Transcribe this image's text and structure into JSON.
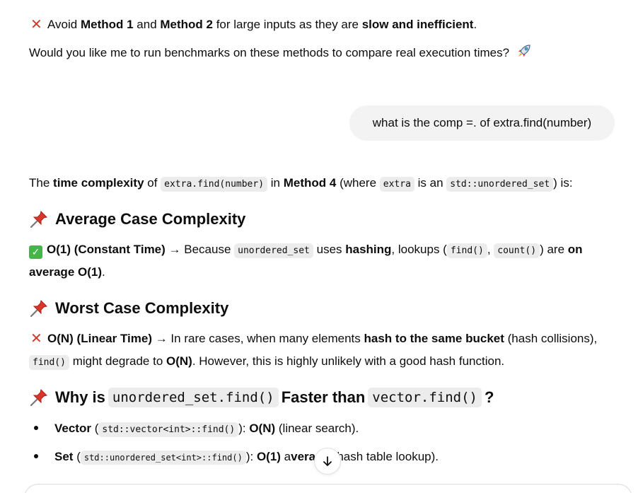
{
  "intro": {
    "icon": "cross-mark-icon",
    "t1": "Avoid ",
    "b1": "Method 1",
    "t2": " and ",
    "b2": "Method 2",
    "t3": " for large inputs as they are ",
    "b3": "slow and inefficient",
    "t4": "."
  },
  "offer": {
    "text": "Would you like me to run benchmarks on these methods to compare real execution times?",
    "icon": "rocket-icon"
  },
  "user_message": "what is the comp =. of extra.find(number)",
  "answer_intro": {
    "t1": "The ",
    "b1": "time complexity",
    "t2": " of ",
    "c1": "extra.find(number)",
    "t3": " in ",
    "b2": "Method 4",
    "t4": " (where ",
    "c2": "extra",
    "t5": " is an ",
    "c3": "std::unordered_set",
    "t6": ") is:"
  },
  "avg_heading": {
    "icon": "pushpin-icon",
    "text": "Average Case Complexity"
  },
  "avg_body": {
    "icon": "check-mark-icon",
    "b1": "O(1) (Constant Time)",
    "t1": " → Because ",
    "c1": "unordered_set",
    "t2": " uses ",
    "b2": "hashing",
    "t3": ", lookups (",
    "c2": "find()",
    "t4": ", ",
    "c3": "count()",
    "t5": ") are ",
    "b3": "on",
    "b4": "average O(1)",
    "t6": "."
  },
  "worst_heading": {
    "icon": "pushpin-icon",
    "text": "Worst Case Complexity"
  },
  "worst_body": {
    "icon": "cross-mark-icon",
    "b1": "O(N) (Linear Time)",
    "t1": " → In rare cases, when many elements ",
    "b2": "hash to the same bucket",
    "t2": " (hash collisions),",
    "c1": "find()",
    "t3": " might degrade to ",
    "b3": "O(N)",
    "t4": ". However, this is highly unlikely with a good hash function."
  },
  "why_heading": {
    "icon": "pushpin-icon",
    "t1": "Why is",
    "c1": "unordered_set.find()",
    "t2": "Faster than",
    "c2": "vector.find()",
    "t3": "?"
  },
  "bullets": [
    {
      "b1": "Vector",
      "t1": " (",
      "c1": "std::vector<int>::find()",
      "t2": "): ",
      "b2": "O(N)",
      "t3": " (linear search)."
    },
    {
      "b1": "Set",
      "t1": " (",
      "c1": "std::unordered_set<int>::find()",
      "t2": "): ",
      "b2": "O(1)",
      "t_hidden": " a",
      "b3": "verage",
      "t3": " (hash table lookup)."
    }
  ],
  "scroll_button": {
    "icon": "arrow-down-icon"
  },
  "colors": {
    "cross": "#d9362b",
    "check": "#44b549",
    "pin": "#d9362b",
    "bubble": "#f3f3f3",
    "code_bg": "#ececec"
  }
}
